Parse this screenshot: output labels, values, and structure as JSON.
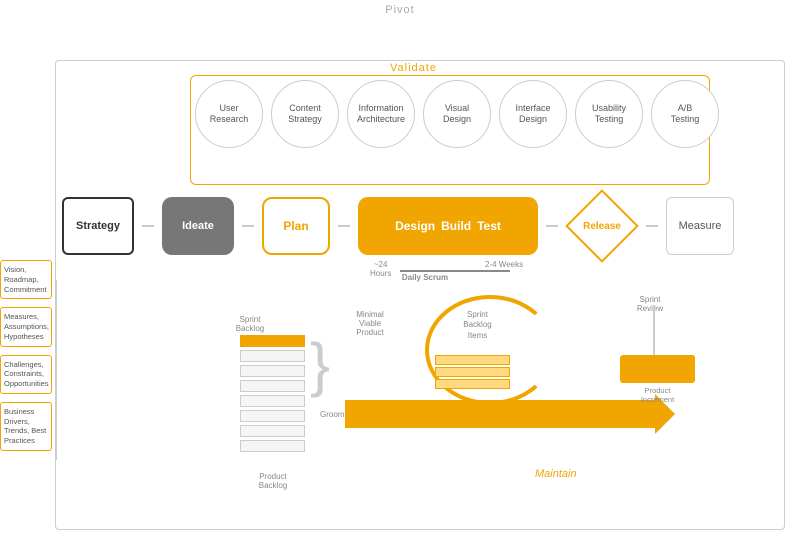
{
  "labels": {
    "pivot": "Pivot",
    "validate": "Validate",
    "strategy": "Strategy",
    "ideate": "Ideate",
    "plan": "Plan",
    "design": "Design",
    "build": "Build",
    "test": "Test",
    "release": "Release",
    "measure": "Measure",
    "maintain": "Maintain",
    "groom": "Groom",
    "sprintBacklog": "Sprint\nBacklog",
    "productBacklog": "Product\nBacklog",
    "minimalViableProduct": "Minimal\nViable\nProduct",
    "hoursLabel": "~24\nHours",
    "weeksLabel": "2-4 Weeks",
    "dailyScrum": "Daily\nScrum",
    "sprintBacklogItems": "Sprint\nBacklog\nItems",
    "sprintReview": "Sprint\nReview",
    "productIncrement": "Product\nIncrement"
  },
  "circles": [
    {
      "id": "user-research",
      "text": "User\nResearch"
    },
    {
      "id": "content-strategy",
      "text": "Content\nStrategy"
    },
    {
      "id": "information-architecture",
      "text": "Information\nArchitecture"
    },
    {
      "id": "visual-design",
      "text": "Visual\nDesign"
    },
    {
      "id": "interface-design",
      "text": "Interface\nDesign"
    },
    {
      "id": "usability-testing",
      "text": "Usability\nTesting"
    },
    {
      "id": "ab-testing",
      "text": "A/B\nTesting"
    }
  ],
  "leftLabels": [
    {
      "id": "vision",
      "text": "Vision,\nRoadmap,\nCommitment"
    },
    {
      "id": "measures",
      "text": "Measures,\nAssumptions,\nHypotheses"
    },
    {
      "id": "challenges",
      "text": "Challenges,\nConstraints,\nOpportunities"
    },
    {
      "id": "business",
      "text": "Business\nDrivers,\nTrends, Best\nPractices"
    }
  ],
  "colors": {
    "orange": "#f0a500",
    "gray": "#777",
    "lightGray": "#ccc",
    "darkGray": "#333",
    "white": "#fff"
  }
}
